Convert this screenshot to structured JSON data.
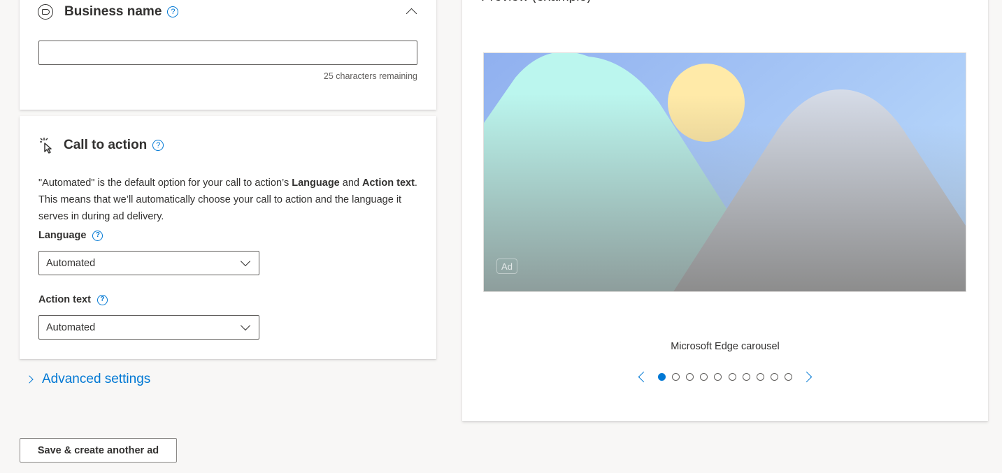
{
  "business_name": {
    "title": "Business name",
    "help": "?",
    "input_value": "",
    "chars_remaining": "25 characters remaining"
  },
  "call_to_action": {
    "title": "Call to action",
    "help": "?",
    "description": {
      "part1": "\"Automated\" is the default option for your call to action’s ",
      "bold1": "Language",
      "part2": " and ",
      "bold2": "Action text",
      "part3": ". This means that we’ll automatically choose your call to action and the language it serves in during ad delivery."
    },
    "language": {
      "label": "Language",
      "help": "?",
      "value": "Automated"
    },
    "action_text": {
      "label": "Action text",
      "help": "?",
      "value": "Automated"
    }
  },
  "advanced_settings": {
    "label": "Advanced settings"
  },
  "footer": {
    "save_another_label": "Save & create another ad"
  },
  "preview": {
    "heading_partial": "Preview (example)",
    "ad_badge": "Ad",
    "carousel_label": "Microsoft Edge carousel",
    "carousel_total": 10,
    "carousel_active_index": 0
  },
  "colors": {
    "accent": "#0078d4",
    "text": "#323130",
    "page_background": "#f8f7f6"
  }
}
